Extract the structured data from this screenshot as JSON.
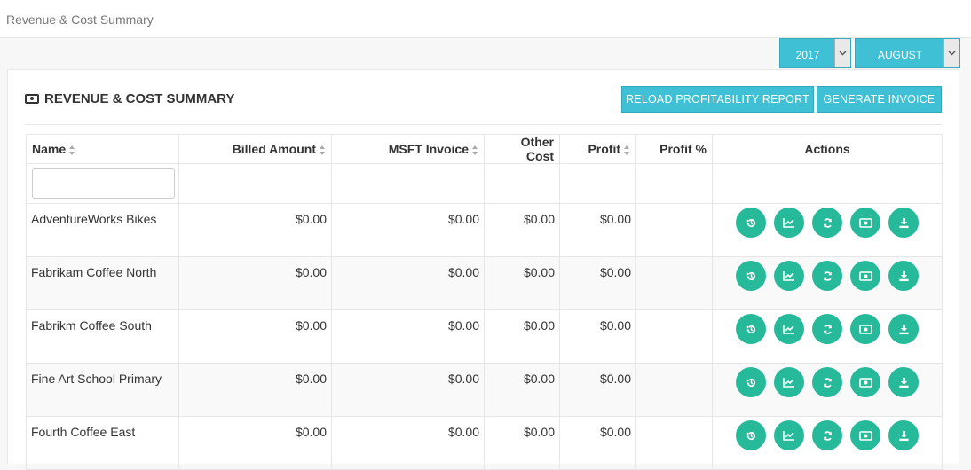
{
  "breadcrumb": "Revenue & Cost Summary",
  "filters": {
    "year": "2017",
    "month": "AUGUST"
  },
  "panel": {
    "title": "REVENUE & COST SUMMARY",
    "reload_label": "RELOAD PROFITABILITY REPORT",
    "invoice_label": "GENERATE INVOICE"
  },
  "table": {
    "headers": {
      "name": "Name",
      "billed": "Billed Amount",
      "msft": "MSFT Invoice",
      "other": "Other Cost",
      "profit": "Profit",
      "profit_pct": "Profit %",
      "actions": "Actions"
    },
    "name_filter_value": "",
    "rows": [
      {
        "name": "AdventureWorks Bikes",
        "billed": "$0.00",
        "msft": "$0.00",
        "other": "$0.00",
        "profit": "$0.00",
        "profit_pct": ""
      },
      {
        "name": "Fabrikam Coffee North",
        "billed": "$0.00",
        "msft": "$0.00",
        "other": "$0.00",
        "profit": "$0.00",
        "profit_pct": ""
      },
      {
        "name": "Fabrikm Coffee South",
        "billed": "$0.00",
        "msft": "$0.00",
        "other": "$0.00",
        "profit": "$0.00",
        "profit_pct": ""
      },
      {
        "name": "Fine Art School Primary",
        "billed": "$0.00",
        "msft": "$0.00",
        "other": "$0.00",
        "profit": "$0.00",
        "profit_pct": ""
      },
      {
        "name": "Fourth Coffee East",
        "billed": "$0.00",
        "msft": "$0.00",
        "other": "$0.00",
        "profit": "$0.00",
        "profit_pct": ""
      }
    ],
    "action_icons": [
      "history-icon",
      "line-chart-icon",
      "refresh-icon",
      "money-icon",
      "download-icon"
    ]
  },
  "colors": {
    "accent": "#3fc0d4",
    "action_green": "#26b99a"
  }
}
